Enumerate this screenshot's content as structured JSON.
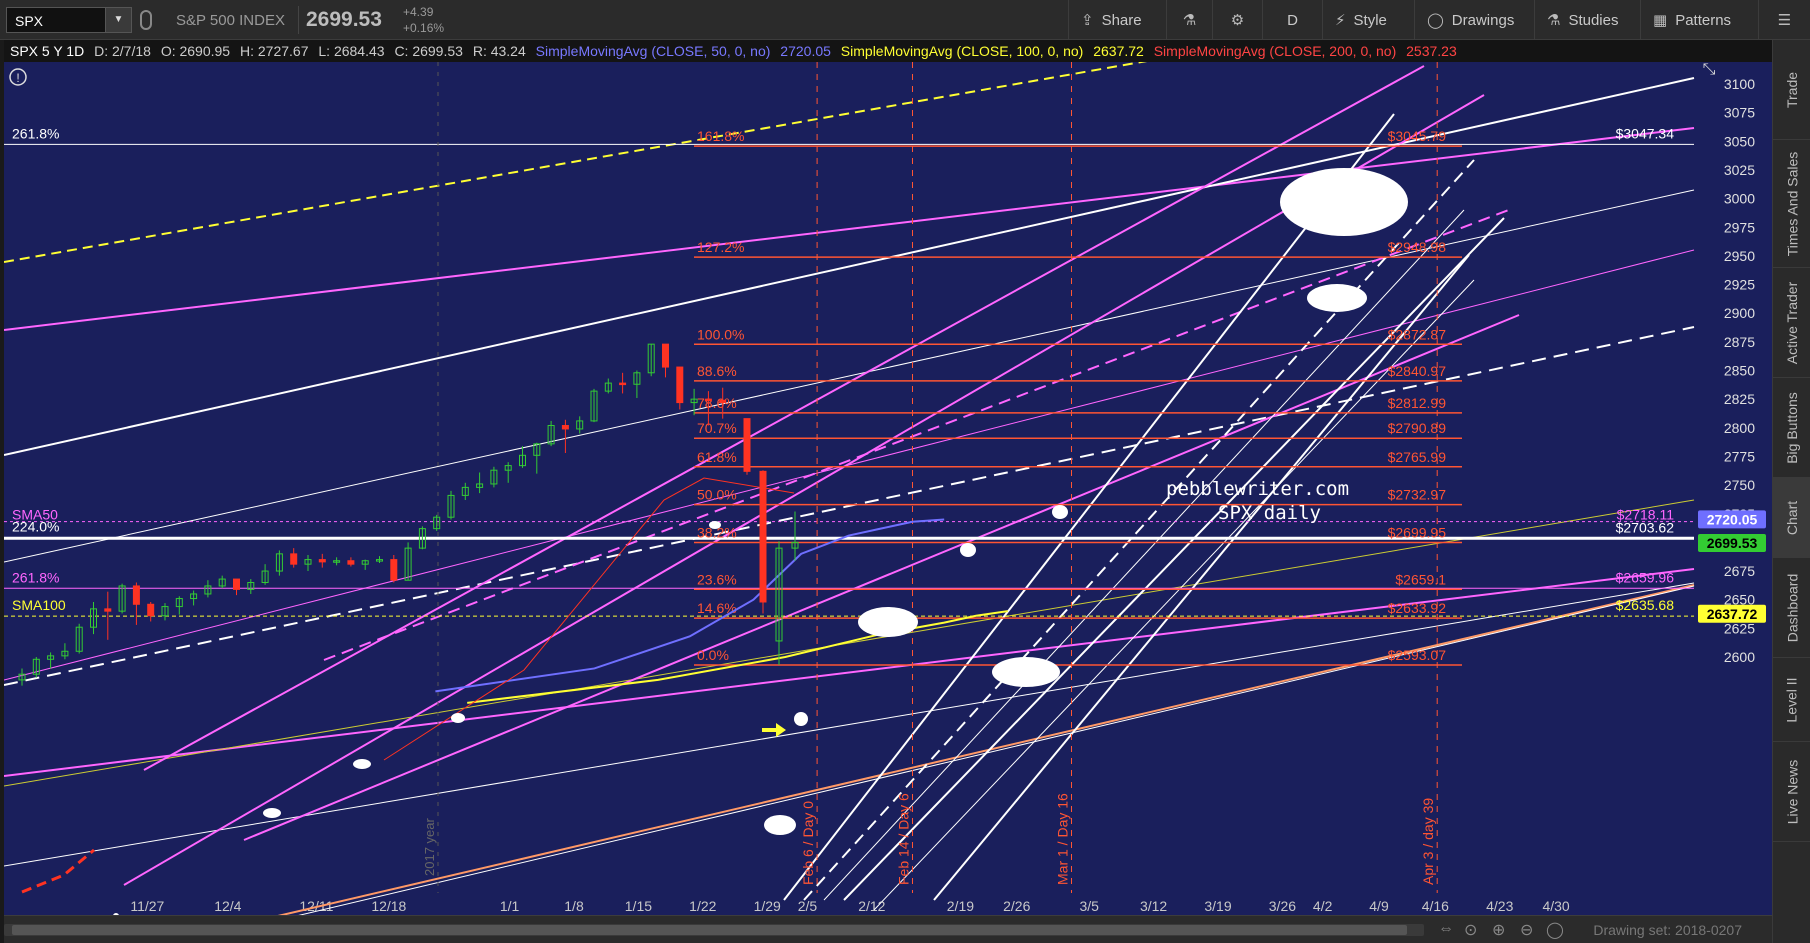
{
  "toolbar": {
    "symbol": "SPX",
    "index_name": "S&P 500 INDEX",
    "last_price": "2699.53",
    "change_abs": "+4.39",
    "change_pct": "+0.16%",
    "buttons": {
      "share": "Share",
      "aggregation": "D",
      "style": "Style",
      "drawings": "Drawings",
      "studies": "Studies",
      "patterns": "Patterns"
    }
  },
  "side_tabs": [
    "Trade",
    "Times And Sales",
    "Active Trader",
    "Big Buttons",
    "Chart",
    "Dashboard",
    "Level II",
    "Live News"
  ],
  "active_side_tab": "Chart",
  "info_bar": {
    "symbol_period": "SPX 5 Y 1D",
    "date": "D: 2/7/18",
    "open": "O: 2690.95",
    "high": "H: 2727.67",
    "low": "L: 2684.43",
    "close": "C: 2699.53",
    "range": "R: 43.24",
    "sma50_label": "SimpleMovingAvg (CLOSE, 50, 0, no)",
    "sma50_value": "2720.05",
    "sma100_label": "SimpleMovingAvg (CLOSE, 100, 0, no)",
    "sma100_value": "2637.72",
    "sma200_label": "SimpleMovingAvg (CLOSE, 200, 0, no)",
    "sma200_value": "2537.23"
  },
  "colors": {
    "chart_bg": "#1a1f5c",
    "sma50": "#6f6fff",
    "sma100": "#ffff33",
    "sma200": "#ff4444",
    "fib": "#ff5533",
    "magenta": "#ff66ff",
    "up_candle": "#33cc33",
    "down_candle": "#ff3322"
  },
  "watermark": [
    "pebblewriter.com",
    "SPX daily"
  ],
  "left_labels": {
    "ext_261_top": "261.8%",
    "sma50": "SMA50",
    "ext_224": "224.0%",
    "ext_261_low": "261.8%",
    "sma100": "SMA100"
  },
  "right_labels": {
    "level_3047": "$3047.34",
    "level_2718": "$2718.11",
    "level_2703": "$2703.62",
    "level_2659": "$2659.96",
    "level_2635": "$2635.68"
  },
  "price_tags": {
    "sma50": "2720.05",
    "last": "2699.53",
    "sma100": "2637.72"
  },
  "fib_levels": [
    {
      "pct": "161.8%",
      "price": "$3045.79",
      "y": 3045.79
    },
    {
      "pct": "127.2%",
      "price": "$2948.98",
      "y": 2948.98
    },
    {
      "pct": "100.0%",
      "price": "$2872.87",
      "y": 2872.87
    },
    {
      "pct": "88.6%",
      "price": "$2840.97",
      "y": 2840.97
    },
    {
      "pct": "78.6%",
      "price": "$2812.99",
      "y": 2812.99
    },
    {
      "pct": "70.7%",
      "price": "$2790.89",
      "y": 2790.89
    },
    {
      "pct": "61.8%",
      "price": "$2765.99",
      "y": 2765.99
    },
    {
      "pct": "50.0%",
      "price": "$2732.97",
      "y": 2732.97
    },
    {
      "pct": "38.2%",
      "price": "$2699.95",
      "y": 2699.95
    },
    {
      "pct": "23.6%",
      "price": "$2659.1",
      "y": 2659.1
    },
    {
      "pct": "14.6%",
      "price": "$2633.92",
      "y": 2633.92
    },
    {
      "pct": "0.0%",
      "price": "$2593.07",
      "y": 2593.07
    }
  ],
  "vertical_markers": [
    {
      "label": "Feb 6 / Day 0",
      "date_index": 49
    },
    {
      "label": "Feb 14 / Day 6",
      "date_index": 55
    },
    {
      "label": "Mar 1 / Day 16",
      "date_index": 65
    },
    {
      "label": "Apr 3 / day 39",
      "date_index": 88
    }
  ],
  "year_marker": "2017 year",
  "chart_data": {
    "type": "candlestick",
    "y_ticks": [
      3100,
      3075,
      3050,
      3025,
      3000,
      2975,
      2950,
      2925,
      2900,
      2875,
      2850,
      2825,
      2800,
      2775,
      2750,
      2725,
      2700,
      2675,
      2650,
      2625,
      2600
    ],
    "x_ticks": [
      "11/27",
      "12/4",
      "12/11",
      "12/18",
      "1/1",
      "1/8",
      "1/15",
      "1/22",
      "1/29",
      "2/5",
      "2/12",
      "2/19",
      "2/26",
      "3/5",
      "3/12",
      "3/19",
      "3/26",
      "4/2",
      "4/9",
      "4/16",
      "4/23",
      "4/30"
    ],
    "ylim": [
      2587,
      3107
    ],
    "candles": [
      [
        2580,
        2590,
        2575,
        2585
      ],
      [
        2585,
        2600,
        2582,
        2598
      ],
      [
        2598,
        2604,
        2590,
        2601
      ],
      [
        2601,
        2612,
        2598,
        2605
      ],
      [
        2605,
        2629,
        2603,
        2626
      ],
      [
        2626,
        2648,
        2620,
        2642
      ],
      [
        2642,
        2657,
        2615,
        2640
      ],
      [
        2640,
        2664,
        2638,
        2662
      ],
      [
        2662,
        2665,
        2628,
        2646
      ],
      [
        2646,
        2648,
        2631,
        2636
      ],
      [
        2636,
        2647,
        2632,
        2644
      ],
      [
        2644,
        2653,
        2637,
        2651
      ],
      [
        2651,
        2658,
        2645,
        2655
      ],
      [
        2655,
        2667,
        2652,
        2662
      ],
      [
        2662,
        2671,
        2660,
        2668
      ],
      [
        2668,
        2666,
        2654,
        2659
      ],
      [
        2659,
        2668,
        2655,
        2665
      ],
      [
        2665,
        2681,
        2663,
        2675
      ],
      [
        2675,
        2693,
        2671,
        2690
      ],
      [
        2690,
        2695,
        2678,
        2681
      ],
      [
        2681,
        2689,
        2675,
        2685
      ],
      [
        2685,
        2690,
        2678,
        2683
      ],
      [
        2683,
        2687,
        2680,
        2684
      ],
      [
        2684,
        2687,
        2679,
        2681
      ],
      [
        2681,
        2685,
        2676,
        2684
      ],
      [
        2684,
        2688,
        2682,
        2685
      ],
      [
        2685,
        2689,
        2665,
        2667
      ],
      [
        2667,
        2700,
        2667,
        2695
      ],
      [
        2695,
        2714,
        2694,
        2712
      ],
      [
        2712,
        2724,
        2710,
        2722
      ],
      [
        2722,
        2745,
        2720,
        2741
      ],
      [
        2741,
        2752,
        2737,
        2748
      ],
      [
        2748,
        2761,
        2743,
        2751
      ],
      [
        2751,
        2766,
        2748,
        2763
      ],
      [
        2763,
        2770,
        2752,
        2767
      ],
      [
        2767,
        2784,
        2765,
        2776
      ],
      [
        2776,
        2787,
        2760,
        2786
      ],
      [
        2786,
        2806,
        2784,
        2802
      ],
      [
        2802,
        2807,
        2778,
        2799
      ],
      [
        2799,
        2810,
        2795,
        2806
      ],
      [
        2806,
        2834,
        2805,
        2832
      ],
      [
        2832,
        2843,
        2830,
        2839
      ],
      [
        2839,
        2848,
        2830,
        2838
      ],
      [
        2838,
        2850,
        2826,
        2848
      ],
      [
        2848,
        2873,
        2845,
        2873
      ],
      [
        2873,
        2860,
        2844,
        2853
      ],
      [
        2853,
        2840,
        2816,
        2822
      ],
      [
        2822,
        2834,
        2811,
        2825
      ],
      [
        2825,
        2832,
        2802,
        2824
      ],
      [
        2824,
        2835,
        2808,
        2822
      ],
      [
        2808,
        2808,
        2759,
        2762
      ],
      [
        2762,
        2763,
        2638,
        2648
      ],
      [
        2614,
        2701,
        2593,
        2695
      ],
      [
        2695,
        2727,
        2684,
        2700
      ]
    ],
    "sma50": [
      [
        30,
        2570
      ],
      [
        40,
        2590
      ],
      [
        46,
        2618
      ],
      [
        50,
        2650
      ],
      [
        53,
        2690
      ],
      [
        56,
        2706
      ],
      [
        58,
        2712
      ],
      [
        60,
        2718
      ],
      [
        62,
        2720
      ]
    ],
    "sma100": [
      [
        60,
        2580
      ],
      [
        63,
        2605
      ],
      [
        66,
        2622
      ],
      [
        70,
        2637
      ]
    ]
  }
}
